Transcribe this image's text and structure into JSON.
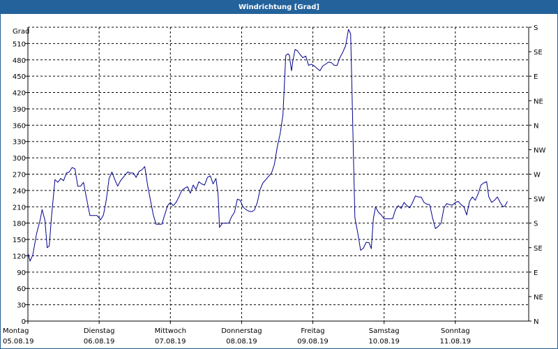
{
  "window": {
    "title": "Windrichtung [Grad]"
  },
  "chart_data": {
    "type": "line",
    "title": "Windrichtung [Grad]",
    "ylabel": "Grad",
    "ylim": [
      0,
      540
    ],
    "grid": true,
    "yticks": [
      0,
      30,
      60,
      90,
      120,
      150,
      180,
      210,
      240,
      270,
      300,
      330,
      360,
      390,
      420,
      450,
      480,
      510
    ],
    "right_axis_labels": [
      {
        "value": 0,
        "label": "N"
      },
      {
        "value": 45,
        "label": "NE"
      },
      {
        "value": 90,
        "label": "E"
      },
      {
        "value": 135,
        "label": "SE"
      },
      {
        "value": 180,
        "label": "S"
      },
      {
        "value": 225,
        "label": "SW"
      },
      {
        "value": 270,
        "label": "W"
      },
      {
        "value": 315,
        "label": "NW"
      },
      {
        "value": 360,
        "label": "N"
      },
      {
        "value": 405,
        "label": "NE"
      },
      {
        "value": 450,
        "label": "E"
      },
      {
        "value": 495,
        "label": "SE"
      },
      {
        "value": 540,
        "label": "S"
      }
    ],
    "days": [
      {
        "day": "Montag",
        "date": "05.08.19"
      },
      {
        "day": "Dienstag",
        "date": "06.08.19"
      },
      {
        "day": "Mittwoch",
        "date": "07.08.19"
      },
      {
        "day": "Donnerstag",
        "date": "08.08.19"
      },
      {
        "day": "Freitag",
        "date": "09.08.19"
      },
      {
        "day": "Samstag",
        "date": "10.08.19"
      },
      {
        "day": "Sonntag",
        "date": "11.08.19"
      }
    ],
    "xlim_days": [
      0,
      7.03
    ],
    "series": [
      {
        "color": "#00008b",
        "points": [
          [
            0.0,
            125
          ],
          [
            0.03,
            110
          ],
          [
            0.07,
            122
          ],
          [
            0.12,
            160
          ],
          [
            0.17,
            185
          ],
          [
            0.2,
            205
          ],
          [
            0.24,
            185
          ],
          [
            0.27,
            135
          ],
          [
            0.3,
            138
          ],
          [
            0.33,
            190
          ],
          [
            0.38,
            260
          ],
          [
            0.42,
            255
          ],
          [
            0.46,
            262
          ],
          [
            0.5,
            258
          ],
          [
            0.54,
            272
          ],
          [
            0.58,
            274
          ],
          [
            0.62,
            282
          ],
          [
            0.66,
            280
          ],
          [
            0.7,
            248
          ],
          [
            0.74,
            248
          ],
          [
            0.78,
            255
          ],
          [
            0.82,
            228
          ],
          [
            0.87,
            194
          ],
          [
            0.92,
            194
          ],
          [
            0.97,
            194
          ],
          [
            1.02,
            186
          ],
          [
            1.06,
            195
          ],
          [
            1.1,
            222
          ],
          [
            1.14,
            262
          ],
          [
            1.18,
            274
          ],
          [
            1.22,
            260
          ],
          [
            1.26,
            248
          ],
          [
            1.3,
            258
          ],
          [
            1.35,
            266
          ],
          [
            1.4,
            274
          ],
          [
            1.44,
            272
          ],
          [
            1.48,
            272
          ],
          [
            1.52,
            264
          ],
          [
            1.56,
            275
          ],
          [
            1.6,
            278
          ],
          [
            1.64,
            284
          ],
          [
            1.68,
            250
          ],
          [
            1.72,
            222
          ],
          [
            1.76,
            195
          ],
          [
            1.8,
            178
          ],
          [
            1.84,
            178
          ],
          [
            1.88,
            178
          ],
          [
            1.92,
            195
          ],
          [
            1.96,
            212
          ],
          [
            2.0,
            218
          ],
          [
            2.04,
            212
          ],
          [
            2.08,
            218
          ],
          [
            2.12,
            228
          ],
          [
            2.16,
            240
          ],
          [
            2.2,
            244
          ],
          [
            2.24,
            247
          ],
          [
            2.28,
            235
          ],
          [
            2.32,
            250
          ],
          [
            2.36,
            242
          ],
          [
            2.4,
            256
          ],
          [
            2.44,
            252
          ],
          [
            2.48,
            250
          ],
          [
            2.52,
            264
          ],
          [
            2.56,
            267
          ],
          [
            2.6,
            252
          ],
          [
            2.64,
            262
          ],
          [
            2.67,
            232
          ],
          [
            2.69,
            172
          ],
          [
            2.73,
            180
          ],
          [
            2.77,
            180
          ],
          [
            2.82,
            180
          ],
          [
            2.86,
            192
          ],
          [
            2.9,
            200
          ],
          [
            2.94,
            224
          ],
          [
            2.98,
            222
          ],
          [
            3.02,
            210
          ],
          [
            3.06,
            205
          ],
          [
            3.1,
            202
          ],
          [
            3.14,
            201
          ],
          [
            3.18,
            204
          ],
          [
            3.22,
            218
          ],
          [
            3.26,
            242
          ],
          [
            3.3,
            254
          ],
          [
            3.34,
            260
          ],
          [
            3.38,
            266
          ],
          [
            3.42,
            272
          ],
          [
            3.46,
            288
          ],
          [
            3.5,
            320
          ],
          [
            3.54,
            344
          ],
          [
            3.58,
            378
          ],
          [
            3.6,
            434
          ],
          [
            3.62,
            488
          ],
          [
            3.65,
            491
          ],
          [
            3.67,
            489
          ],
          [
            3.7,
            460
          ],
          [
            3.72,
            478
          ],
          [
            3.75,
            499
          ],
          [
            3.78,
            497
          ],
          [
            3.82,
            490
          ],
          [
            3.86,
            484
          ],
          [
            3.9,
            487
          ],
          [
            3.94,
            470
          ],
          [
            3.98,
            472
          ],
          [
            4.02,
            469
          ],
          [
            4.06,
            464
          ],
          [
            4.1,
            460
          ],
          [
            4.14,
            469
          ],
          [
            4.18,
            472
          ],
          [
            4.22,
            476
          ],
          [
            4.26,
            475
          ],
          [
            4.3,
            470
          ],
          [
            4.34,
            470
          ],
          [
            4.38,
            484
          ],
          [
            4.42,
            494
          ],
          [
            4.46,
            506
          ],
          [
            4.5,
            536
          ],
          [
            4.53,
            528
          ],
          [
            4.55,
            420
          ],
          [
            4.57,
            300
          ],
          [
            4.59,
            190
          ],
          [
            4.63,
            162
          ],
          [
            4.67,
            130
          ],
          [
            4.71,
            134
          ],
          [
            4.75,
            145
          ],
          [
            4.79,
            144
          ],
          [
            4.82,
            133
          ],
          [
            4.85,
            188
          ],
          [
            4.88,
            210
          ],
          [
            4.92,
            200
          ],
          [
            4.96,
            195
          ],
          [
            5.0,
            188
          ],
          [
            5.04,
            188
          ],
          [
            5.08,
            188
          ],
          [
            5.12,
            188
          ],
          [
            5.16,
            205
          ],
          [
            5.2,
            212
          ],
          [
            5.24,
            207
          ],
          [
            5.28,
            218
          ],
          [
            5.32,
            212
          ],
          [
            5.36,
            208
          ],
          [
            5.4,
            218
          ],
          [
            5.44,
            230
          ],
          [
            5.48,
            228
          ],
          [
            5.52,
            228
          ],
          [
            5.56,
            218
          ],
          [
            5.6,
            215
          ],
          [
            5.64,
            214
          ],
          [
            5.68,
            190
          ],
          [
            5.72,
            170
          ],
          [
            5.76,
            174
          ],
          [
            5.8,
            180
          ],
          [
            5.84,
            208
          ],
          [
            5.88,
            216
          ],
          [
            5.92,
            214
          ],
          [
            5.96,
            213
          ],
          [
            6.0,
            218
          ],
          [
            6.04,
            220
          ],
          [
            6.08,
            214
          ],
          [
            6.12,
            210
          ],
          [
            6.16,
            195
          ],
          [
            6.2,
            220
          ],
          [
            6.24,
            228
          ],
          [
            6.28,
            222
          ],
          [
            6.32,
            234
          ],
          [
            6.36,
            250
          ],
          [
            6.4,
            254
          ],
          [
            6.44,
            256
          ],
          [
            6.47,
            228
          ],
          [
            6.51,
            218
          ],
          [
            6.55,
            222
          ],
          [
            6.59,
            228
          ],
          [
            6.63,
            218
          ],
          [
            6.67,
            210
          ],
          [
            6.7,
            212
          ],
          [
            6.73,
            220
          ]
        ]
      }
    ]
  }
}
